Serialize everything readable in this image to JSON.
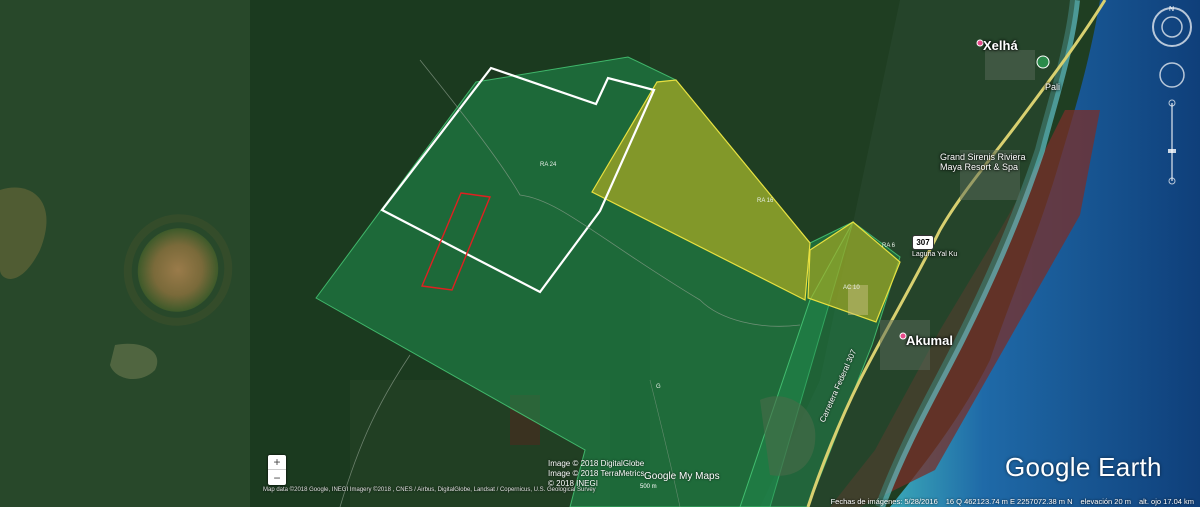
{
  "places": {
    "xelha": "Xelhá",
    "akumal": "Akumal",
    "grand_sirenis": "Grand Sirenis Riviera Maya Resort & Spa",
    "pali": "Pali",
    "yalku": "Laguna Yal Ku",
    "road_name": "Carretera Federal 307"
  },
  "highway_shield": "307",
  "polygon_labels": {
    "white": "RA 24",
    "yellow": "RA 16",
    "yellow_small": "AC 10",
    "green_east": "RA 6",
    "green_south": "G"
  },
  "credits": [
    "Image © 2018 DigitalGlobe",
    "Image © 2018 TerraMetrics",
    "© 2018 INEGI"
  ],
  "attribution": "Map data ©2018 Google, INEGI Imagery ©2018 , CNES / Airbus, DigitalGlobe, Landsat / Copernicus, U.S. Geological Survey",
  "scale_label": "500 m",
  "google_my_maps": "Google My Maps",
  "google_earth": "Google Earth",
  "status": {
    "imagery_date": "Fechas de imágenes: 5/28/2016",
    "coordinates": "16 Q 462123.74 m E 2257072.38 m N",
    "elevation": "elevación   20 m",
    "eye_alt": "alt. ojo  17.04 km"
  },
  "zoom": {
    "in": "+",
    "out": "−"
  },
  "nav_north": "N",
  "colors": {
    "green_overlay": "#1f8f4f",
    "yellow_overlay": "#b8b020",
    "white_outline": "#ffffff",
    "red_outline": "#e02020",
    "water": "#1c4f8a",
    "sargassum": "#7a2f2a"
  }
}
